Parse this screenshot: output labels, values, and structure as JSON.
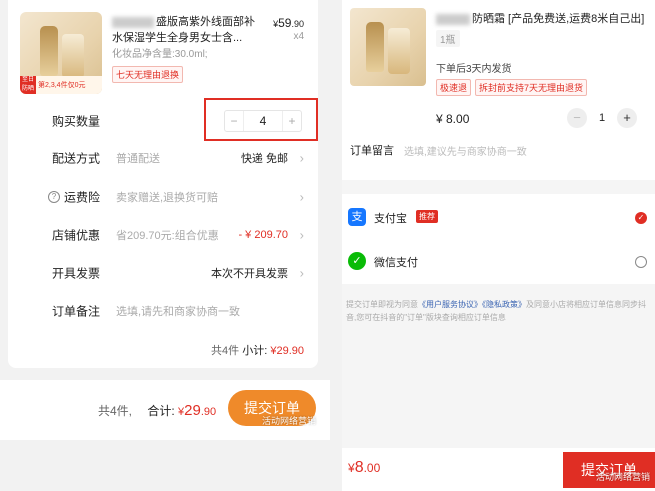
{
  "left": {
    "product": {
      "title_visible": "盛版高紫外线面部补水保湿学生全身男女士含...",
      "price_symbol": "¥",
      "price_main": "59",
      "price_decimal": ".90",
      "quantity_label": "x4",
      "spec": "化妆品净含量:30.0ml;",
      "return_tag": "七天无理由退换",
      "thumb_promo_tag": "至日防晒",
      "thumb_promo_text": "第2,3,4件仅0元"
    },
    "quantity_row": {
      "label": "购买数量",
      "value": "4",
      "minus": "−",
      "plus": "+"
    },
    "shipping_row": {
      "label": "配送方式",
      "sub": "普通配送",
      "value": "快递 免邮"
    },
    "insurance_row": {
      "label": "运费险",
      "sub": "卖家赠送,退换货可赔"
    },
    "discount_row": {
      "label": "店铺优惠",
      "sub": "省209.70元:组合优惠",
      "value": "- ¥ 209.70"
    },
    "invoice_row": {
      "label": "开具发票",
      "value": "本次不开具发票"
    },
    "remark_row": {
      "label": "订单备注",
      "sub": "选填,请先和商家协商一致"
    },
    "subtotal": {
      "count_text": "共4件",
      "label": "小计:",
      "amount": "¥29.90"
    },
    "footer": {
      "count_text": "共4件,",
      "total_label": "合计:",
      "currency": "¥",
      "amount_main": "29",
      "amount_decimal": ".90",
      "submit_label": "提交订单"
    },
    "watermark": "活动网络营销"
  },
  "right": {
    "product": {
      "title_visible": "防晒霜 [产品免费送,运费8米自己出]",
      "spec": "1瓶",
      "ship_text": "下单后3天内发货",
      "tags": [
        "极速退",
        "拆封前支持7天无理由退货"
      ],
      "price": "¥ 8.00",
      "quantity": "1",
      "minus": "−",
      "plus": "+"
    },
    "note": {
      "label": "订单留言",
      "placeholder": "选填,建议先与商家协商一致"
    },
    "payments": [
      {
        "name": "支付宝",
        "badge": "推荐",
        "icon": "alipay-icon",
        "selected": true
      },
      {
        "name": "微信支付",
        "badge": "",
        "icon": "wechat-pay-icon",
        "selected": false
      }
    ],
    "agreement": {
      "prefix": "提交订单即视为同意",
      "link1": "《用户服务协议》",
      "link2": "《隐私政策》",
      "suffix": "及同意小店将相应订单信息同步抖音,您可在抖音的\"订单\"版块查询相应订单信息"
    },
    "footer": {
      "currency": "¥",
      "amount_main": "8",
      "amount_decimal": ".00",
      "submit_label": "提交订单"
    },
    "watermark": "活动网络营销"
  },
  "colors": {
    "accent_red": "#e02e24",
    "orange_button": "#ef8a2a",
    "alipay_blue": "#1677ff",
    "wechat_green": "#09bb07"
  }
}
